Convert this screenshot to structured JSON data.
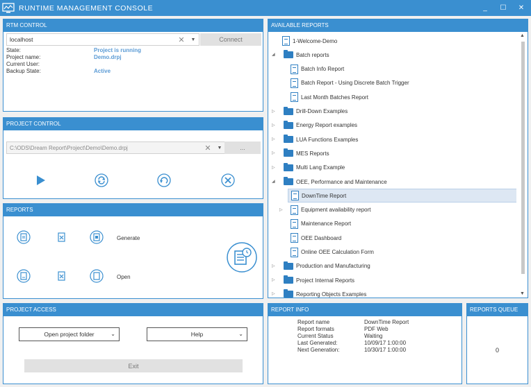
{
  "window": {
    "title": "RUNTIME MANAGEMENT CONSOLE",
    "min": "_",
    "max": "☐",
    "close": "✕"
  },
  "rtm_control": {
    "header": "RTM CONTROL",
    "host_value": "localhost",
    "connect_label": "Connect",
    "rows": [
      {
        "label": "State:",
        "value": "Project is running"
      },
      {
        "label": "Project name:",
        "value": "Demo.drpj"
      },
      {
        "label": "Current User:",
        "value": ""
      },
      {
        "label": "Backup State:",
        "value": "Active"
      }
    ]
  },
  "project_control": {
    "header": "PROJECT CONTROL",
    "path_value": "C:\\ODS\\Dream Report\\Project\\Demo\\Demo.drpj",
    "browse_label": "..."
  },
  "reports": {
    "header": "REPORTS",
    "generate_label": "Generate",
    "open_label": "Open"
  },
  "project_access": {
    "header": "PROJECT ACCESS",
    "open_folder_label": "Open project folder",
    "help_label": "Help",
    "exit_label": "Exit"
  },
  "available_reports": {
    "header": "AVAILABLE REPORTS",
    "items": [
      {
        "label": "1-Welcome-Demo",
        "type": "doc",
        "level": 1,
        "arrow": ""
      },
      {
        "label": "Batch reports",
        "type": "folder",
        "level": 0,
        "arrow": "◢"
      },
      {
        "label": "Batch Info Report",
        "type": "doc",
        "level": 2,
        "arrow": ""
      },
      {
        "label": "Batch Report - Using Discrete Batch Trigger",
        "type": "doc",
        "level": 2,
        "arrow": ""
      },
      {
        "label": "Last Month Batches Report",
        "type": "doc",
        "level": 2,
        "arrow": ""
      },
      {
        "label": "Drill-Down Examples",
        "type": "folder",
        "level": 0,
        "arrow": "▷"
      },
      {
        "label": "Energy Report examples",
        "type": "folder",
        "level": 0,
        "arrow": "▷"
      },
      {
        "label": "LUA Functions Examples",
        "type": "folder",
        "level": 0,
        "arrow": "▷"
      },
      {
        "label": "MES Reports",
        "type": "folder",
        "level": 0,
        "arrow": "▷"
      },
      {
        "label": "Multi Lang Example",
        "type": "folder",
        "level": 0,
        "arrow": "▷"
      },
      {
        "label": "OEE, Performance and Maintenance",
        "type": "folder",
        "level": 0,
        "arrow": "◢"
      },
      {
        "label": "DownTime Report",
        "type": "doc",
        "level": 2,
        "arrow": "",
        "selected": true
      },
      {
        "label": "Equipment availability report",
        "type": "doc",
        "level": 2,
        "arrow": "▷"
      },
      {
        "label": "Maintenance Report",
        "type": "doc",
        "level": 2,
        "arrow": ""
      },
      {
        "label": "OEE Dashboard",
        "type": "doc",
        "level": 2,
        "arrow": ""
      },
      {
        "label": "Online OEE Calculation Form",
        "type": "doc",
        "level": 2,
        "arrow": ""
      },
      {
        "label": "Production and Manufacturing",
        "type": "folder",
        "level": 0,
        "arrow": "▷"
      },
      {
        "label": "Project Internal Reports",
        "type": "folder",
        "level": 0,
        "arrow": "▷"
      },
      {
        "label": "Reporting Objects Examples",
        "type": "folder",
        "level": 0,
        "arrow": "▷"
      }
    ]
  },
  "report_info": {
    "header": "REPORT INFO",
    "rows": [
      {
        "label": "Report name",
        "value": "DownTime Report"
      },
      {
        "label": "Report formats",
        "value": "PDF Web"
      },
      {
        "label": "Current Status",
        "value": "Waiting"
      },
      {
        "label": "Last Generated:",
        "value": "10/09/17 1:00:00"
      },
      {
        "label": "Next Generation:",
        "value": "10/30/17 1:00:00"
      }
    ]
  },
  "reports_queue": {
    "header": "REPORTS QUEUE",
    "count": "0"
  },
  "colors": {
    "accent": "#3a8fd0",
    "link": "#5b9bd5",
    "selected_bg": "#dde7f3"
  }
}
